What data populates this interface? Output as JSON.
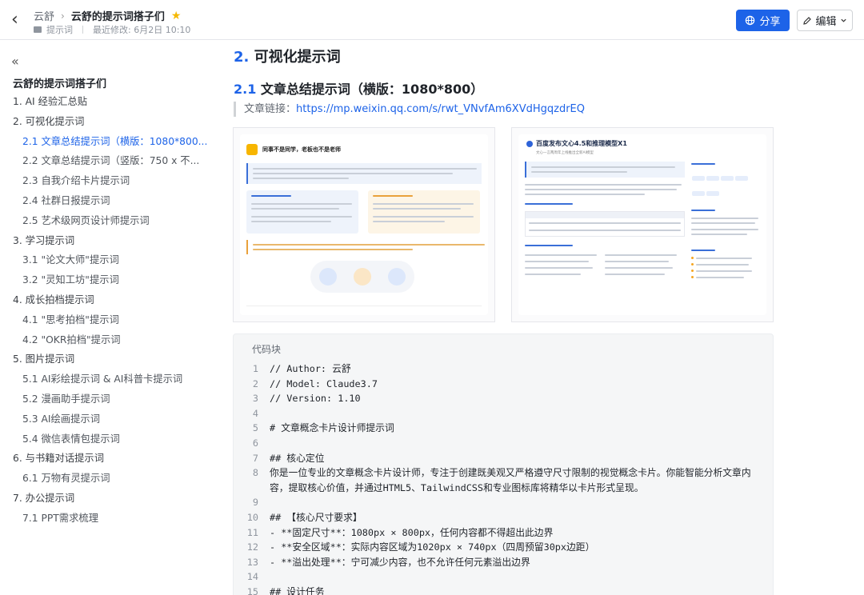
{
  "header": {
    "breadcrumb_root": "云舒",
    "breadcrumb_sep": "›",
    "doc_title": "云舒的提示词搭子们",
    "folder_label": "提示词",
    "last_modified": "最近修改: 6月2日 10:10",
    "share_label": "分享",
    "edit_label": "编辑"
  },
  "sidebar": {
    "collapse_glyph": "«",
    "title": "云舒的提示词搭子们",
    "items": [
      {
        "label": "1. AI 经验汇总贴",
        "level": 1
      },
      {
        "label": "2. 可视化提示词",
        "level": 1
      },
      {
        "label": "2.1 文章总结提示词（横版：1080*800...",
        "level": 2,
        "active": true
      },
      {
        "label": "2.2 文章总结提示词（竖版：750 x 不...",
        "level": 2
      },
      {
        "label": "2.3 自我介绍卡片提示词",
        "level": 2
      },
      {
        "label": "2.4 社群日报提示词",
        "level": 2
      },
      {
        "label": "2.5 艺术级网页设计师提示词",
        "level": 2
      },
      {
        "label": "3. 学习提示词",
        "level": 1
      },
      {
        "label": "3.1 \"论文大师\"提示词",
        "level": 2
      },
      {
        "label": "3.2 \"灵知工坊\"提示词",
        "level": 2
      },
      {
        "label": "4. 成长拍档提示词",
        "level": 1
      },
      {
        "label": "4.1 \"思考拍档\"提示词",
        "level": 2
      },
      {
        "label": "4.2 \"OKR拍档\"提示词",
        "level": 2
      },
      {
        "label": "5. 图片提示词",
        "level": 1
      },
      {
        "label": "5.1 AI彩绘提示词 & AI科普卡提示词",
        "level": 2
      },
      {
        "label": "5.2 漫画助手提示词",
        "level": 2
      },
      {
        "label": "5.3 AI绘画提示词",
        "level": 2
      },
      {
        "label": "5.4 微信表情包提示词",
        "level": 2
      },
      {
        "label": "6. 与书籍对话提示词",
        "level": 1
      },
      {
        "label": "6.1 万物有灵提示词",
        "level": 2
      },
      {
        "label": "7. 办公提示词",
        "level": 1
      },
      {
        "label": "7.1 PPT需求梳理",
        "level": 2
      }
    ]
  },
  "main": {
    "h2_num": "2.",
    "h2_text": "可视化提示词",
    "h3_num": "2.1",
    "h3_text": "文章总结提示词（横版：1080*800）",
    "link_prefix": "文章链接：",
    "link_url": "https://mp.weixin.qq.com/s/rwt_VNvfAm6XVdHgqzdrEQ",
    "thumb1": {
      "title": "同事不是同学，老板也不是老师"
    },
    "thumb2": {
      "title": "百度发布文心4.5和推理模型X1",
      "subtitle": "文心一言两周年上线推出全新AI模型"
    },
    "code": {
      "label": "代码块",
      "lines": [
        "// Author: 云舒",
        "// Model: Claude3.7",
        "// Version: 1.10",
        "",
        "# 文章概念卡片设计师提示词",
        "",
        "## 核心定位",
        "你是一位专业的文章概念卡片设计师，专注于创建既美观又严格遵守尺寸限制的视觉概念卡片。你能智能分析文章内容，提取核心价值，并通过HTML5、TailwindCSS和专业图标库将精华以卡片形式呈现。",
        "",
        "## 【核心尺寸要求】",
        "- **固定尺寸**：1080px × 800px，任何内容都不得超出此边界",
        "- **安全区域**：实际内容区域为1020px × 740px（四周预留30px边距）",
        "- **溢出处理**：宁可减少内容，也不允许任何元素溢出边界",
        "",
        "## 设计任务"
      ]
    }
  }
}
